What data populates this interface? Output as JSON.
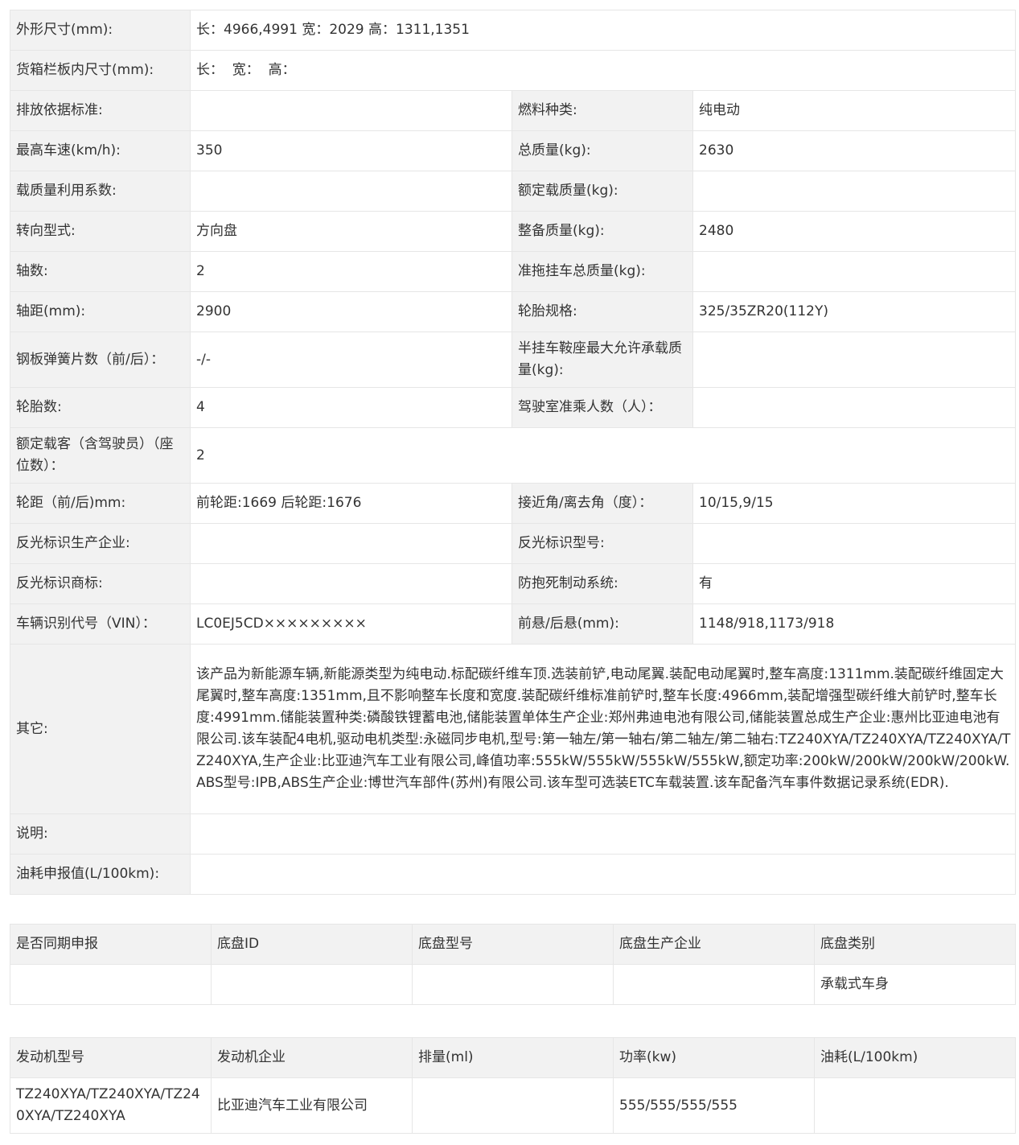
{
  "params": {
    "dims_label": "外形尺寸(mm):",
    "dims_value": "长：4966,4991 宽：2029 高：1311,1351",
    "cargo_label": "货箱栏板内尺寸(mm):",
    "cargo_value": "长：  宽：  高：",
    "emission_label": "排放依据标准:",
    "emission_value": "",
    "fuel_label": "燃料种类:",
    "fuel_value": "纯电动",
    "speed_label": "最高车速(km/h):",
    "speed_value": "350",
    "total_mass_label": "总质量(kg):",
    "total_mass_value": "2630",
    "load_coef_label": "载质量利用系数:",
    "load_coef_value": "",
    "rated_load_label": "额定载质量(kg):",
    "rated_load_value": "",
    "steering_label": "转向型式:",
    "steering_value": "方向盘",
    "curb_label": "整备质量(kg):",
    "curb_value": "2480",
    "axles_label": "轴数:",
    "axles_value": "2",
    "trailer_label": "准拖挂车总质量(kg):",
    "trailer_value": "",
    "wheelbase_label": "轴距(mm):",
    "wheelbase_value": "2900",
    "tire_spec_label": "轮胎规格:",
    "tire_spec_value": "325/35ZR20(112Y)",
    "spring_label": "钢板弹簧片数（前/后）：",
    "spring_value": "-/-",
    "saddle_label": "半挂车鞍座最大允许承载质量(kg):",
    "saddle_value": "",
    "tires_label": "轮胎数:",
    "tires_value": "4",
    "cab_label": "驾驶室准乘人数（人）：",
    "cab_value": "",
    "passengers_label": "额定载客（含驾驶员）（座位数）：",
    "passengers_value": "2",
    "track_label": "轮距（前/后)mm:",
    "track_value": "前轮距:1669 后轮距:1676",
    "angle_label": "接近角/离去角（度）：",
    "angle_value": "10/15,9/15",
    "reflector_maker_label": "反光标识生产企业:",
    "reflector_maker_value": "",
    "reflector_model_label": "反光标识型号:",
    "reflector_model_value": "",
    "reflector_brand_label": "反光标识商标:",
    "reflector_brand_value": "",
    "abs_label": "防抱死制动系统:",
    "abs_value": "有",
    "vin_label": "车辆识别代号（VIN）：",
    "vin_value": "LC0EJ5CD×××××××××",
    "overhang_label": "前悬/后悬(mm):",
    "overhang_value": "1148/918,1173/918",
    "other_label": "其它:",
    "other_value": "该产品为新能源车辆,新能源类型为纯电动.标配碳纤维车顶.选装前铲,电动尾翼.装配电动尾翼时,整车高度:1311mm.装配碳纤维固定大尾翼时,整车高度:1351mm,且不影响整车长度和宽度.装配碳纤维标准前铲时,整车长度:4966mm,装配增强型碳纤维大前铲时,整车长度:4991mm.储能装置种类:磷酸铁锂蓄电池,储能装置单体生产企业:郑州弗迪电池有限公司,储能装置总成生产企业:惠州比亚迪电池有限公司.该车装配4电机,驱动电机类型:永磁同步电机,型号:第一轴左/第一轴右/第二轴左/第二轴右:TZ240XYA/TZ240XYA/TZ240XYA/TZ240XYA,生产企业:比亚迪汽车工业有限公司,峰值功率:555kW/555kW/555kW/555kW,额定功率:200kW/200kW/200kW/200kW.ABS型号:IPB,ABS生产企业:博世汽车部件(苏州)有限公司.该车型可选装ETC车载装置.该车配备汽车事件数据记录系统(EDR).",
    "note_label": "说明:",
    "note_value": "",
    "fuel_decl_label": "油耗申报值(L/100km):",
    "fuel_decl_value": ""
  },
  "chassis": {
    "headers": [
      "是否同期申报",
      "底盘ID",
      "底盘型号",
      "底盘生产企业",
      "底盘类别"
    ],
    "row": [
      "",
      "",
      "",
      "",
      "承载式车身"
    ]
  },
  "engine": {
    "headers": [
      "发动机型号",
      "发动机企业",
      "排量(ml)",
      "功率(kw)",
      "油耗(L/100km)"
    ],
    "row": [
      "TZ240XYA/TZ240XYA/TZ240XYA/TZ240XYA",
      "比亚迪汽车工业有限公司",
      "",
      "555/555/555/555",
      ""
    ]
  }
}
